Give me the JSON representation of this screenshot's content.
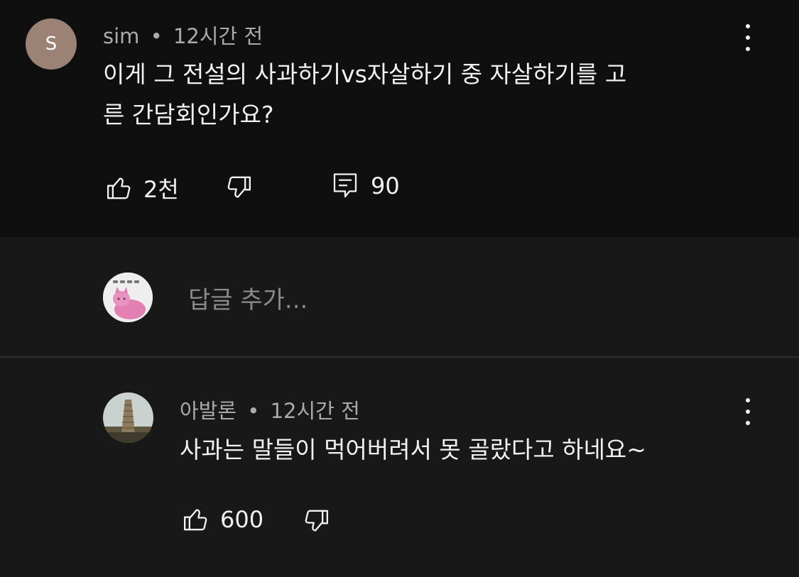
{
  "comment": {
    "avatar_letter": "S",
    "author": "sim",
    "separator": "•",
    "time": "12시간 전",
    "text_line1": "이게 그 전설의 사과하기vs자살하기 중 자살하기를 고",
    "text_line2": "른 간담회인가요?",
    "like_count": "2천",
    "reply_count": "90"
  },
  "reply_input": {
    "placeholder": "답글 추가..."
  },
  "reply": {
    "author": "아발론",
    "separator": "•",
    "time": "12시간 전",
    "text": "사과는 말들이 먹어버려서 못 골랐다고 하네요~",
    "like_count": "600"
  },
  "colors": {
    "background": "#0f0f0f",
    "reply_section": "#181818",
    "text": "#f1f1f1",
    "muted": "#aaaaaa"
  },
  "icons": [
    "thumbs-up-icon",
    "thumbs-down-icon",
    "comment-icon",
    "more-vert-icon"
  ]
}
